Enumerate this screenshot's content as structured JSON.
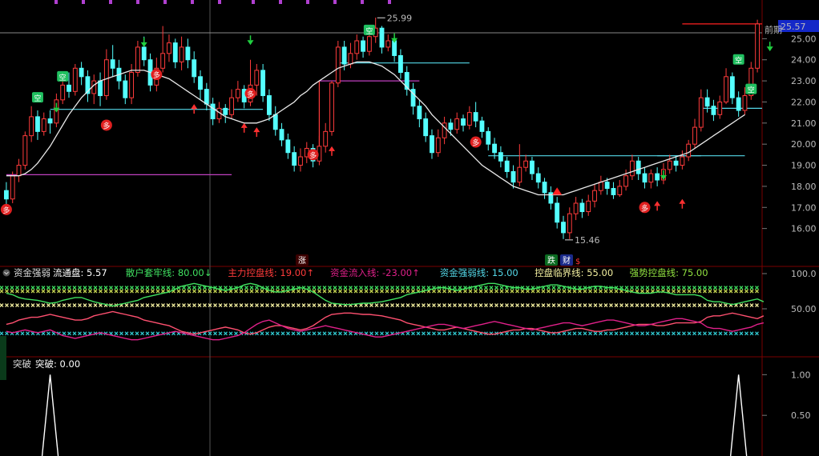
{
  "colors": {
    "up": "#ff3b3b",
    "down": "#54ffff",
    "ma": "#e8e8e8",
    "magenta_line": "#c040c0",
    "green_line": "#40e060",
    "pink_line": "#ff5070",
    "crimson_line": "#e0208a",
    "grid": "#7a0000",
    "price_tag_bg": "#1428c8"
  },
  "top_marks": {
    "text": "▪ ▪ ▪ ▪ ▪ ▪ ▪ ▪ ▪ ▪ ▪ ▪ ▪"
  },
  "price_panel": {
    "y_ticks": [
      "25.00",
      "24.00",
      "23.00",
      "22.00",
      "21.00",
      "20.00",
      "19.00",
      "18.00",
      "17.00",
      "16.00"
    ],
    "current_price": "25.57",
    "prev_high_label": "前期",
    "high_label": "25.99",
    "low_label": "15.46",
    "signal_kong": "空",
    "signal_duo": "多",
    "event_zhang": "涨",
    "event_die": "跌",
    "event_cai": "财",
    "event_s": "$"
  },
  "indicator_panel": {
    "name": "资金强弱",
    "legend": [
      {
        "label": "流通盘: 5.57",
        "color": "#ffffff"
      },
      {
        "label": "散户套牢线: 80.00↓",
        "color": "#40e060"
      },
      {
        "label": "主力控盘线: 19.00↑",
        "color": "#ff3b3b"
      },
      {
        "label": "资金流入线: -23.00↑",
        "color": "#e0208a"
      },
      {
        "label": "资金强弱线: 15.00",
        "color": "#54d8e8"
      },
      {
        "label": "控盘临界线: 55.00",
        "color": "#f4f0a0"
      },
      {
        "label": "强势控盘线: 75.00",
        "color": "#90e040"
      }
    ],
    "y_ticks": [
      "100.0",
      "50.00"
    ]
  },
  "break_panel": {
    "name": "突破",
    "legend": "突破: 0.00",
    "y_ticks": [
      "1.00",
      "0.50"
    ]
  },
  "chart_data": {
    "type": "candlestick",
    "price_ylim": [
      15.0,
      26.0
    ],
    "indicator_ylim": [
      0,
      100
    ],
    "break_ylim": [
      0,
      1.2
    ],
    "candles": [
      [
        17.8,
        17.4,
        18.2,
        17.0
      ],
      [
        17.4,
        18.5,
        18.7,
        17.2
      ],
      [
        18.5,
        19.0,
        19.3,
        18.2
      ],
      [
        19.0,
        20.4,
        20.6,
        18.8
      ],
      [
        20.4,
        21.3,
        21.8,
        20.1
      ],
      [
        21.3,
        20.6,
        21.6,
        20.2
      ],
      [
        20.6,
        21.2,
        21.5,
        20.4
      ],
      [
        21.2,
        21.0,
        21.6,
        20.5
      ],
      [
        21.0,
        22.1,
        22.4,
        20.8
      ],
      [
        22.1,
        22.8,
        23.2,
        21.9
      ],
      [
        22.8,
        22.5,
        23.4,
        22.2
      ],
      [
        22.5,
        23.6,
        23.8,
        22.3
      ],
      [
        23.6,
        23.2,
        23.9,
        22.8
      ],
      [
        23.2,
        22.4,
        23.5,
        22.0
      ],
      [
        22.4,
        23.0,
        23.3,
        21.9
      ],
      [
        23.0,
        22.3,
        23.4,
        21.8
      ],
      [
        22.3,
        24.0,
        24.5,
        22.1
      ],
      [
        24.0,
        23.6,
        24.7,
        23.2
      ],
      [
        23.6,
        23.0,
        24.0,
        22.6
      ],
      [
        23.0,
        22.2,
        23.3,
        21.9
      ],
      [
        22.2,
        23.4,
        23.8,
        21.9
      ],
      [
        23.4,
        24.6,
        24.9,
        23.2
      ],
      [
        24.6,
        24.0,
        25.1,
        23.7
      ],
      [
        24.0,
        22.8,
        24.3,
        22.5
      ],
      [
        22.8,
        23.6,
        24.1,
        22.5
      ],
      [
        23.6,
        24.3,
        25.6,
        23.4
      ],
      [
        24.3,
        24.8,
        25.2,
        23.9
      ],
      [
        24.8,
        23.9,
        25.0,
        23.6
      ],
      [
        23.9,
        24.6,
        25.1,
        23.5
      ],
      [
        24.6,
        24.0,
        25.0,
        23.6
      ],
      [
        24.0,
        23.2,
        24.4,
        22.9
      ],
      [
        23.2,
        22.6,
        23.5,
        22.1
      ],
      [
        22.6,
        21.9,
        22.9,
        21.6
      ],
      [
        21.9,
        21.2,
        22.2,
        20.9
      ],
      [
        21.2,
        21.7,
        22.0,
        21.0
      ],
      [
        21.7,
        21.4,
        21.9,
        21.0
      ],
      [
        21.4,
        22.2,
        22.6,
        21.2
      ],
      [
        22.2,
        22.6,
        23.0,
        22.0
      ],
      [
        22.6,
        22.0,
        22.8,
        21.7
      ],
      [
        22.0,
        22.8,
        24.0,
        21.8
      ],
      [
        22.8,
        23.5,
        23.8,
        22.3
      ],
      [
        23.5,
        22.3,
        23.8,
        22.0
      ],
      [
        22.3,
        21.4,
        22.6,
        21.1
      ],
      [
        21.4,
        20.7,
        21.8,
        20.4
      ],
      [
        20.7,
        20.2,
        21.0,
        19.9
      ],
      [
        20.2,
        19.6,
        20.5,
        19.3
      ],
      [
        19.6,
        19.0,
        19.9,
        18.7
      ],
      [
        19.0,
        19.4,
        19.8,
        18.7
      ],
      [
        19.4,
        19.8,
        20.1,
        19.1
      ],
      [
        19.8,
        19.2,
        20.0,
        18.9
      ],
      [
        19.2,
        19.9,
        20.4,
        19.0
      ],
      [
        19.9,
        20.6,
        21.0,
        19.6
      ],
      [
        20.6,
        22.9,
        23.0,
        20.4
      ],
      [
        22.9,
        24.6,
        24.9,
        22.7
      ],
      [
        24.6,
        23.8,
        24.9,
        23.5
      ],
      [
        23.8,
        24.3,
        24.8,
        23.6
      ],
      [
        24.3,
        24.9,
        25.2,
        24.0
      ],
      [
        24.9,
        24.4,
        25.1,
        24.1
      ],
      [
        24.4,
        25.1,
        25.6,
        24.2
      ],
      [
        25.1,
        25.5,
        26.0,
        24.8
      ],
      [
        25.5,
        24.6,
        25.6,
        24.3
      ],
      [
        24.6,
        24.9,
        25.2,
        24.4
      ],
      [
        24.9,
        24.2,
        25.1,
        23.9
      ],
      [
        24.2,
        23.4,
        24.5,
        23.1
      ],
      [
        23.4,
        22.6,
        23.7,
        22.3
      ],
      [
        22.6,
        21.8,
        22.9,
        21.4
      ],
      [
        21.8,
        21.2,
        22.1,
        20.8
      ],
      [
        21.2,
        20.4,
        21.5,
        20.1
      ],
      [
        20.4,
        19.6,
        20.7,
        19.3
      ],
      [
        19.6,
        20.3,
        20.7,
        19.4
      ],
      [
        20.3,
        21.0,
        21.3,
        20.0
      ],
      [
        21.0,
        20.7,
        21.2,
        20.4
      ],
      [
        20.7,
        21.2,
        21.5,
        20.5
      ],
      [
        21.2,
        20.9,
        21.4,
        20.6
      ],
      [
        20.9,
        21.5,
        21.8,
        20.7
      ],
      [
        21.5,
        21.1,
        22.0,
        20.8
      ],
      [
        21.1,
        20.6,
        21.3,
        20.3
      ],
      [
        20.6,
        20.0,
        20.8,
        19.7
      ],
      [
        20.0,
        19.6,
        20.3,
        19.3
      ],
      [
        19.6,
        19.2,
        19.9,
        18.9
      ],
      [
        19.2,
        18.7,
        19.4,
        18.4
      ],
      [
        18.7,
        18.2,
        19.0,
        17.9
      ],
      [
        18.2,
        18.9,
        20.0,
        18.0
      ],
      [
        18.9,
        19.2,
        19.5,
        18.7
      ],
      [
        19.2,
        18.6,
        19.4,
        18.3
      ],
      [
        18.6,
        18.2,
        18.9,
        17.9
      ],
      [
        18.2,
        17.7,
        18.4,
        17.4
      ],
      [
        17.7,
        17.2,
        18.0,
        16.9
      ],
      [
        17.2,
        16.3,
        17.5,
        16.0
      ],
      [
        16.3,
        15.8,
        16.6,
        15.5
      ],
      [
        15.8,
        16.7,
        17.0,
        15.5
      ],
      [
        16.7,
        17.2,
        17.5,
        16.4
      ],
      [
        17.2,
        16.8,
        17.4,
        16.5
      ],
      [
        16.8,
        17.3,
        17.6,
        16.6
      ],
      [
        17.3,
        17.8,
        18.1,
        17.0
      ],
      [
        17.8,
        18.2,
        18.5,
        17.6
      ],
      [
        18.2,
        17.9,
        18.4,
        17.6
      ],
      [
        17.9,
        17.6,
        18.2,
        17.4
      ],
      [
        17.6,
        18.0,
        18.3,
        17.5
      ],
      [
        18.0,
        18.5,
        18.8,
        17.8
      ],
      [
        18.5,
        19.2,
        19.5,
        18.3
      ],
      [
        19.2,
        18.6,
        19.4,
        18.3
      ],
      [
        18.6,
        18.2,
        18.9,
        17.9
      ],
      [
        18.2,
        18.6,
        18.8,
        17.9
      ],
      [
        18.6,
        18.3,
        18.9,
        18.0
      ],
      [
        18.3,
        18.8,
        19.1,
        18.1
      ],
      [
        18.8,
        19.2,
        19.5,
        18.6
      ],
      [
        19.2,
        19.0,
        19.4,
        18.7
      ],
      [
        19.0,
        19.4,
        19.7,
        18.8
      ],
      [
        19.4,
        20.0,
        20.2,
        19.2
      ],
      [
        20.0,
        20.8,
        21.2,
        19.8
      ],
      [
        20.8,
        22.2,
        22.6,
        20.6
      ],
      [
        22.2,
        21.8,
        22.6,
        21.5
      ],
      [
        21.8,
        21.4,
        22.1,
        21.1
      ],
      [
        21.4,
        22.0,
        22.3,
        21.2
      ],
      [
        22.0,
        23.2,
        23.6,
        21.9
      ],
      [
        23.2,
        22.2,
        23.4,
        21.9
      ],
      [
        22.2,
        21.6,
        22.5,
        21.3
      ],
      [
        21.6,
        22.3,
        22.7,
        21.4
      ],
      [
        22.3,
        23.6,
        23.9,
        22.1
      ],
      [
        23.6,
        25.7,
        25.9,
        23.4
      ]
    ],
    "ma": [
      18.5,
      18.5,
      18.5,
      18.6,
      18.8,
      19.1,
      19.5,
      19.9,
      20.4,
      20.9,
      21.4,
      21.8,
      22.2,
      22.5,
      22.8,
      23.0,
      23.1,
      23.2,
      23.3,
      23.4,
      23.5,
      23.5,
      23.5,
      23.4,
      23.3,
      23.2,
      23.1,
      22.9,
      22.7,
      22.5,
      22.3,
      22.1,
      21.9,
      21.7,
      21.5,
      21.3,
      21.2,
      21.1,
      21.0,
      21.0,
      21.0,
      21.1,
      21.2,
      21.4,
      21.6,
      21.8,
      22.0,
      22.3,
      22.5,
      22.8,
      23.0,
      23.2,
      23.4,
      23.6,
      23.7,
      23.8,
      23.9,
      23.9,
      23.9,
      23.8,
      23.7,
      23.5,
      23.3,
      23.0,
      22.7,
      22.4,
      22.1,
      21.8,
      21.4,
      21.1,
      20.8,
      20.5,
      20.2,
      19.9,
      19.6,
      19.3,
      19.0,
      18.8,
      18.6,
      18.4,
      18.2,
      18.0,
      17.9,
      17.8,
      17.7,
      17.6,
      17.6,
      17.6,
      17.6,
      17.6,
      17.7,
      17.8,
      17.9,
      18.0,
      18.1,
      18.2,
      18.3,
      18.4,
      18.5,
      18.6,
      18.7,
      18.8,
      18.9,
      19.0,
      19.1,
      19.2,
      19.3,
      19.4,
      19.5,
      19.6,
      19.8,
      20.0,
      20.2,
      20.4,
      20.6,
      20.8,
      21.0,
      21.2,
      21.4
    ],
    "breakout": [
      0,
      0,
      0,
      0,
      0,
      0,
      0,
      1,
      0,
      0,
      0,
      0,
      0,
      0,
      0,
      0,
      0,
      0,
      0,
      0,
      0,
      0,
      0,
      0,
      0,
      0,
      0,
      0,
      0,
      0,
      0,
      0,
      0,
      0,
      0,
      0,
      0,
      0,
      0,
      0,
      0,
      0,
      0,
      0,
      0,
      0,
      0,
      0,
      0,
      0,
      0,
      0,
      0,
      0,
      0,
      0,
      0,
      0,
      0,
      0,
      0,
      0,
      0,
      0,
      0,
      0,
      0,
      0,
      0,
      0,
      0,
      0,
      0,
      0,
      0,
      0,
      0,
      0,
      0,
      0,
      0,
      0,
      0,
      0,
      0,
      0,
      0,
      0,
      0,
      0,
      0,
      0,
      0,
      0,
      0,
      0,
      0,
      0,
      0,
      0,
      0,
      0,
      0,
      0,
      0,
      0,
      0,
      0,
      0,
      0,
      0,
      0,
      0,
      0,
      0,
      0,
      0,
      1,
      0,
      0,
      0
    ],
    "line_retail": [
      72,
      70,
      66,
      64,
      63,
      62,
      60,
      58,
      59,
      62,
      64,
      66,
      66,
      63,
      60,
      58,
      56,
      54,
      56,
      58,
      60,
      62,
      66,
      68,
      70,
      72,
      74,
      78,
      82,
      84,
      86,
      84,
      82,
      80,
      78,
      76,
      78,
      80,
      84,
      86,
      84,
      80,
      76,
      74,
      74,
      76,
      78,
      80,
      78,
      74,
      68,
      62,
      58,
      57,
      56,
      56,
      57,
      58,
      58,
      59,
      60,
      62,
      64,
      66,
      70,
      72,
      74,
      76,
      78,
      80,
      80,
      78,
      76,
      78,
      80,
      82,
      84,
      86,
      86,
      84,
      82,
      80,
      80,
      78,
      78,
      80,
      82,
      84,
      84,
      82,
      80,
      78,
      78,
      80,
      82,
      82,
      80,
      80,
      78,
      76,
      74,
      72,
      72,
      72,
      74,
      74,
      72,
      70,
      70,
      70,
      70,
      68,
      62,
      60,
      60,
      58,
      56,
      58,
      60,
      62,
      64,
      60
    ],
    "line_main": [
      28,
      30,
      34,
      36,
      38,
      38,
      40,
      42,
      40,
      38,
      36,
      34,
      34,
      36,
      40,
      42,
      44,
      46,
      44,
      42,
      40,
      38,
      34,
      32,
      30,
      28,
      26,
      22,
      18,
      16,
      14,
      16,
      18,
      20,
      22,
      24,
      22,
      20,
      16,
      14,
      16,
      20,
      24,
      26,
      26,
      24,
      22,
      20,
      22,
      26,
      32,
      38,
      42,
      43,
      44,
      44,
      43,
      42,
      42,
      41,
      40,
      38,
      36,
      34,
      30,
      28,
      26,
      24,
      22,
      20,
      20,
      22,
      24,
      22,
      20,
      18,
      16,
      14,
      14,
      16,
      18,
      20,
      20,
      22,
      22,
      20,
      18,
      16,
      16,
      18,
      20,
      22,
      22,
      20,
      18,
      18,
      20,
      20,
      22,
      24,
      26,
      28,
      28,
      28,
      26,
      26,
      28,
      30,
      30,
      30,
      30,
      32,
      38,
      40,
      40,
      42,
      44,
      42,
      40,
      38,
      36,
      40
    ],
    "line_flow": [
      18,
      16,
      18,
      20,
      18,
      16,
      18,
      20,
      16,
      12,
      10,
      8,
      10,
      12,
      14,
      16,
      14,
      12,
      10,
      8,
      6,
      6,
      8,
      10,
      12,
      14,
      16,
      18,
      16,
      14,
      12,
      10,
      8,
      6,
      6,
      8,
      10,
      12,
      16,
      22,
      28,
      32,
      34,
      30,
      26,
      22,
      20,
      18,
      20,
      22,
      24,
      26,
      24,
      22,
      20,
      18,
      16,
      14,
      12,
      10,
      10,
      12,
      14,
      16,
      18,
      20,
      22,
      24,
      26,
      28,
      28,
      26,
      24,
      22,
      24,
      26,
      28,
      30,
      32,
      30,
      28,
      26,
      24,
      22,
      20,
      22,
      24,
      26,
      28,
      30,
      30,
      28,
      26,
      28,
      30,
      32,
      34,
      34,
      32,
      30,
      28,
      26,
      26,
      28,
      30,
      32,
      34,
      36,
      36,
      34,
      32,
      30,
      24,
      22,
      22,
      20,
      18,
      20,
      22,
      24,
      28,
      30
    ],
    "ref_lines": {
      "retail": 80,
      "strong": 75,
      "critical": 55,
      "weak": 15
    }
  }
}
